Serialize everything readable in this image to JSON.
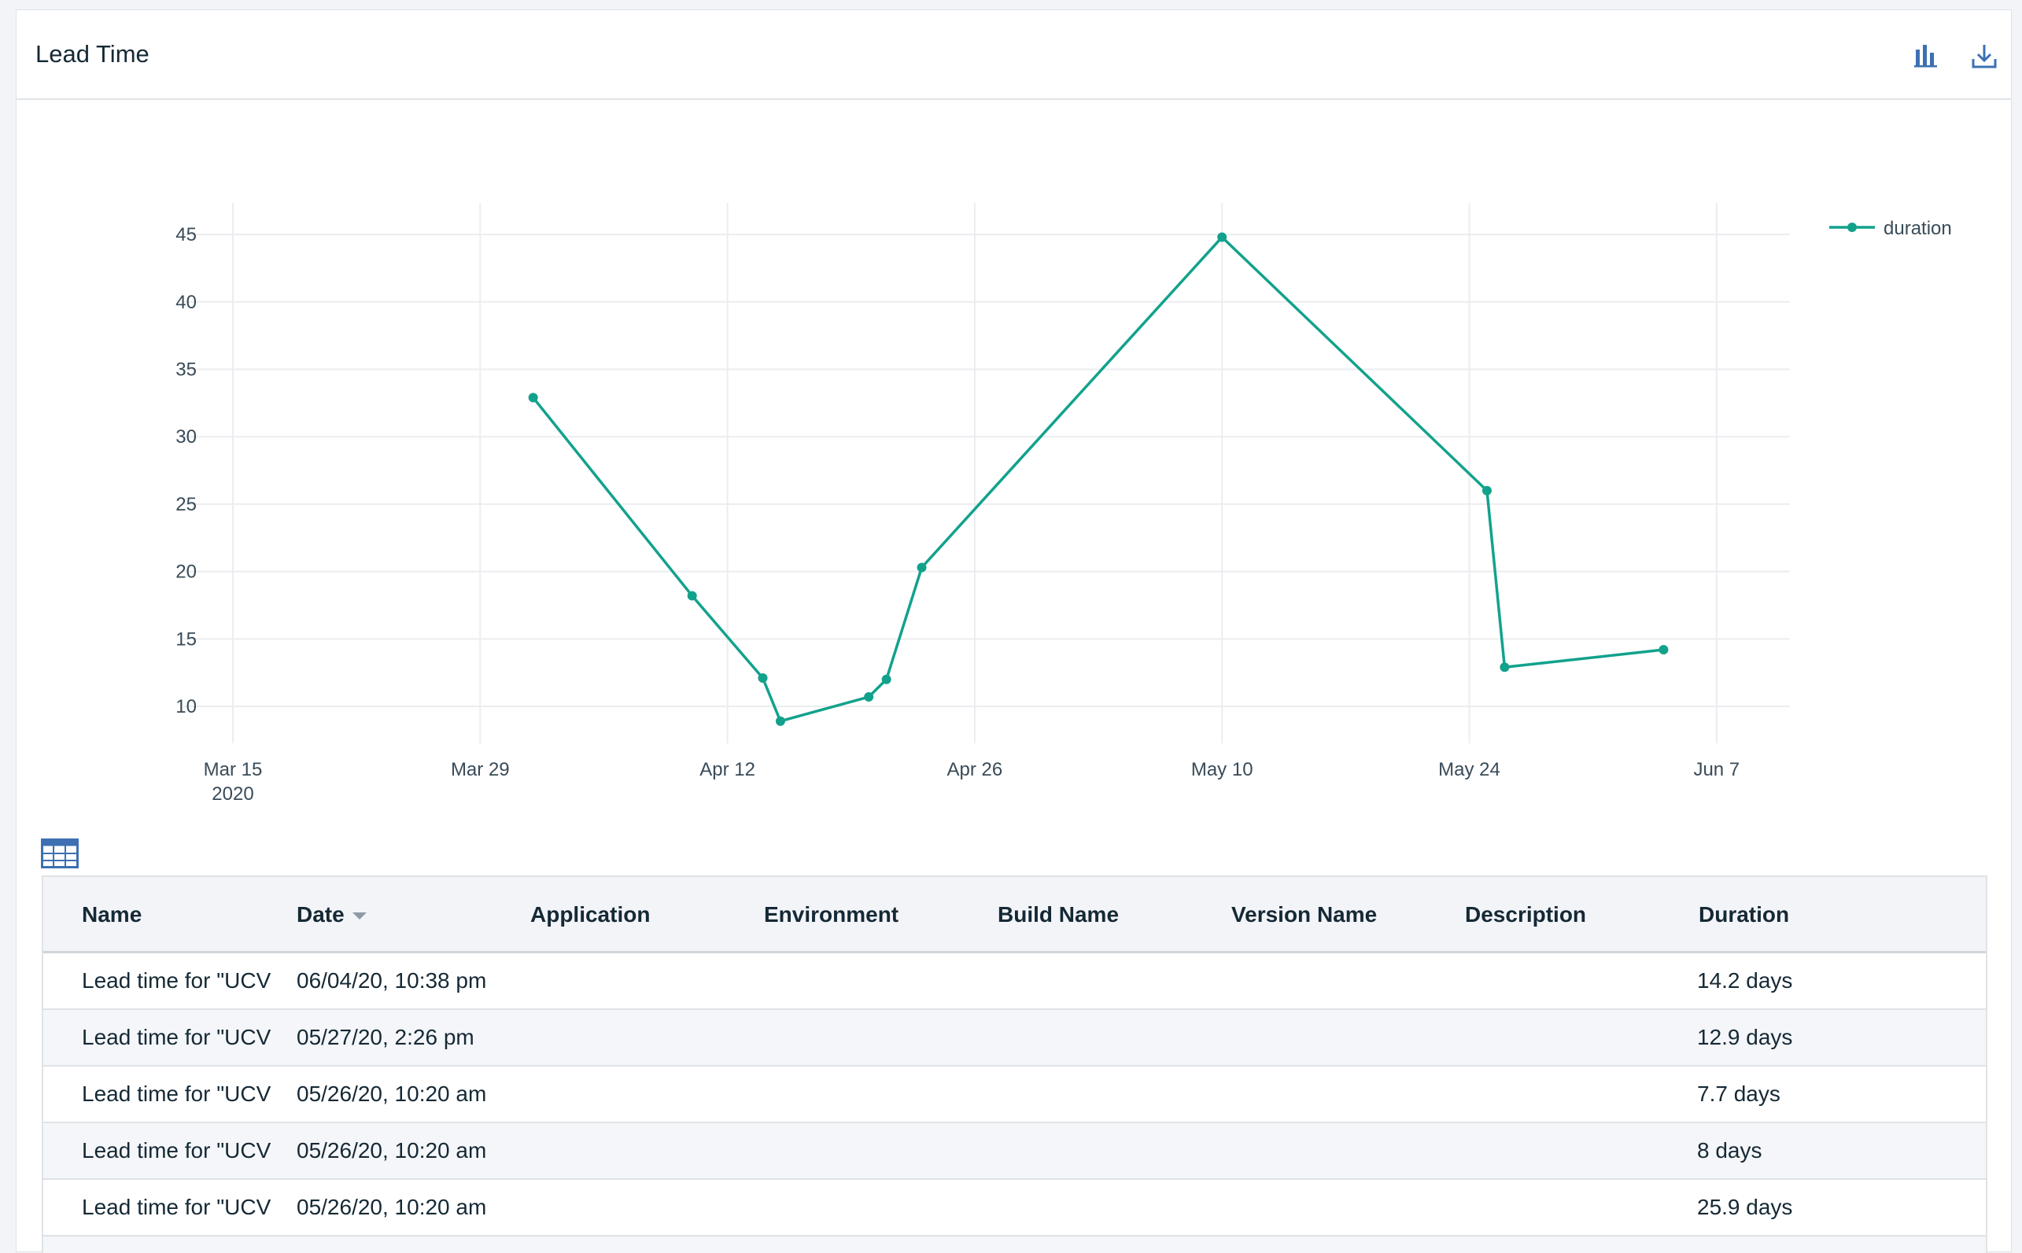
{
  "card": {
    "title": "Lead Time",
    "icons": {
      "chart_toggle": "bar-chart-icon",
      "download": "download-icon"
    }
  },
  "chart_data": {
    "type": "line",
    "title": "",
    "xlabel": "",
    "ylabel": "",
    "x_axis_type": "date",
    "x_ticks": [
      "Mar 15\n2020",
      "Mar 29",
      "Apr 12",
      "Apr 26",
      "May 10",
      "May 24",
      "Jun 7"
    ],
    "y_ticks": [
      10,
      15,
      20,
      25,
      30,
      35,
      40,
      45
    ],
    "ylim": [
      7.5,
      47
    ],
    "xlim": [
      "2020-03-15",
      "2020-06-15"
    ],
    "grid": true,
    "legend_position": "top-right",
    "color": "#12a28c",
    "series": [
      {
        "name": "duration",
        "x": [
          "2020-04-01",
          "2020-04-10",
          "2020-04-14",
          "2020-04-15",
          "2020-04-20",
          "2020-04-21",
          "2020-04-23",
          "2020-05-10",
          "2020-05-25",
          "2020-05-26",
          "2020-06-04"
        ],
        "y": [
          32.9,
          18.2,
          12.1,
          8.9,
          10.7,
          12.0,
          20.3,
          44.8,
          26.0,
          12.9,
          14.2
        ]
      }
    ]
  },
  "table": {
    "icon": "table-icon",
    "columns": [
      {
        "label": "Name"
      },
      {
        "label": "Date",
        "sorted": "desc"
      },
      {
        "label": "Application"
      },
      {
        "label": "Environment"
      },
      {
        "label": "Build Name"
      },
      {
        "label": "Version Name"
      },
      {
        "label": "Description"
      },
      {
        "label": "Duration"
      }
    ],
    "rows": [
      {
        "name": "Lead time for \"UCV ·",
        "date": "06/04/20, 10:38 pm",
        "application": "",
        "environment": "",
        "build": "",
        "version": "",
        "description": "",
        "duration": "14.2 days"
      },
      {
        "name": "Lead time for \"UCV ·",
        "date": "05/27/20, 2:26 pm",
        "application": "",
        "environment": "",
        "build": "",
        "version": "",
        "description": "",
        "duration": "12.9 days"
      },
      {
        "name": "Lead time for \"UCV ·",
        "date": "05/26/20, 10:20 am",
        "application": "",
        "environment": "",
        "build": "",
        "version": "",
        "description": "",
        "duration": "7.7 days"
      },
      {
        "name": "Lead time for \"UCV ·",
        "date": "05/26/20, 10:20 am",
        "application": "",
        "environment": "",
        "build": "",
        "version": "",
        "description": "",
        "duration": "8 days"
      },
      {
        "name": "Lead time for \"UCV ·",
        "date": "05/26/20, 10:20 am",
        "application": "",
        "environment": "",
        "build": "",
        "version": "",
        "description": "",
        "duration": "25.9 days"
      }
    ]
  }
}
